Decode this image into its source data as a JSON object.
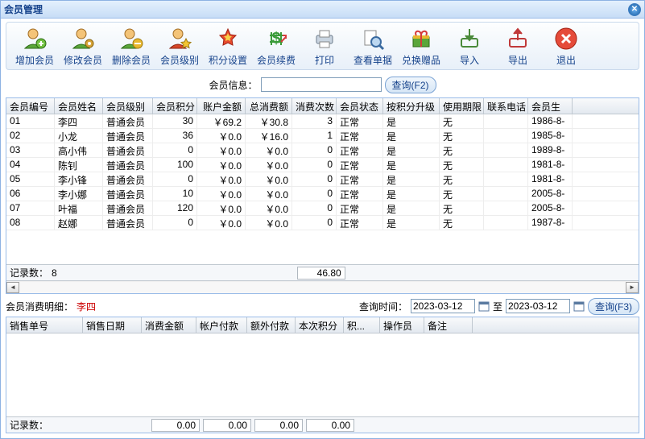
{
  "title": "会员管理",
  "toolbar": [
    {
      "key": "add",
      "label": "增加会员"
    },
    {
      "key": "edit",
      "label": "修改会员"
    },
    {
      "key": "del",
      "label": "删除会员"
    },
    {
      "key": "level",
      "label": "会员级别"
    },
    {
      "key": "points",
      "label": "积分设置"
    },
    {
      "key": "renew",
      "label": "会员续费"
    },
    {
      "key": "print",
      "label": "打印"
    },
    {
      "key": "view",
      "label": "查看单据"
    },
    {
      "key": "gift",
      "label": "兑换赠品"
    },
    {
      "key": "import",
      "label": "导入"
    },
    {
      "key": "export",
      "label": "导出"
    },
    {
      "key": "exit",
      "label": "退出"
    }
  ],
  "search": {
    "label": "会员信息：",
    "value": "",
    "btn": "查询(F2)"
  },
  "columns": [
    "会员编号",
    "会员姓名",
    "会员级别",
    "会员积分",
    "账户金额",
    "总消费额",
    "消费次数",
    "会员状态",
    "按积分升级",
    "使用期限",
    "联系电话",
    "会员生"
  ],
  "rows": [
    {
      "id": "01",
      "name": "李四",
      "level": "普通会员",
      "pts": "30",
      "bal": "￥69.2",
      "cons": "￥30.8",
      "cnt": "3",
      "st": "正常",
      "up": "是",
      "exp": "无",
      "tel": "",
      "bd": "1986-8-"
    },
    {
      "id": "02",
      "name": "小龙",
      "level": "普通会员",
      "pts": "36",
      "bal": "￥0.0",
      "cons": "￥16.0",
      "cnt": "1",
      "st": "正常",
      "up": "是",
      "exp": "无",
      "tel": "",
      "bd": "1985-8-"
    },
    {
      "id": "03",
      "name": "高小伟",
      "level": "普通会员",
      "pts": "0",
      "bal": "￥0.0",
      "cons": "￥0.0",
      "cnt": "0",
      "st": "正常",
      "up": "是",
      "exp": "无",
      "tel": "",
      "bd": "1989-8-"
    },
    {
      "id": "04",
      "name": "陈钊",
      "level": "普通会员",
      "pts": "100",
      "bal": "￥0.0",
      "cons": "￥0.0",
      "cnt": "0",
      "st": "正常",
      "up": "是",
      "exp": "无",
      "tel": "",
      "bd": "1981-8-"
    },
    {
      "id": "05",
      "name": "李小锋",
      "level": "普通会员",
      "pts": "0",
      "bal": "￥0.0",
      "cons": "￥0.0",
      "cnt": "0",
      "st": "正常",
      "up": "是",
      "exp": "无",
      "tel": "",
      "bd": "1981-8-"
    },
    {
      "id": "06",
      "name": "李小娜",
      "level": "普通会员",
      "pts": "10",
      "bal": "￥0.0",
      "cons": "￥0.0",
      "cnt": "0",
      "st": "正常",
      "up": "是",
      "exp": "无",
      "tel": "",
      "bd": "2005-8-"
    },
    {
      "id": "07",
      "name": "叶福",
      "level": "普通会员",
      "pts": "120",
      "bal": "￥0.0",
      "cons": "￥0.0",
      "cnt": "0",
      "st": "正常",
      "up": "是",
      "exp": "无",
      "tel": "",
      "bd": "2005-8-"
    },
    {
      "id": "08",
      "name": "赵娜",
      "level": "普通会员",
      "pts": "0",
      "bal": "￥0.0",
      "cons": "￥0.0",
      "cnt": "0",
      "st": "正常",
      "up": "是",
      "exp": "无",
      "tel": "",
      "bd": "1987-8-"
    }
  ],
  "summary1": {
    "label": "记录数：",
    "count": "8",
    "total": "46.80"
  },
  "detail": {
    "label": "会员消费明细：",
    "name": "李四",
    "qlabel": "查询时间：",
    "from": "2023-03-12",
    "to_lbl": "至",
    "to": "2023-03-12",
    "btn": "查询(F3)"
  },
  "dcols": [
    "销售单号",
    "销售日期",
    "消费金额",
    "帐户付款",
    "额外付款",
    "本次积分",
    "积...",
    "操作员",
    "备注"
  ],
  "summary2": {
    "label": "记录数：",
    "v1": "0.00",
    "v2": "0.00",
    "v3": "0.00",
    "v4": "0.00"
  }
}
